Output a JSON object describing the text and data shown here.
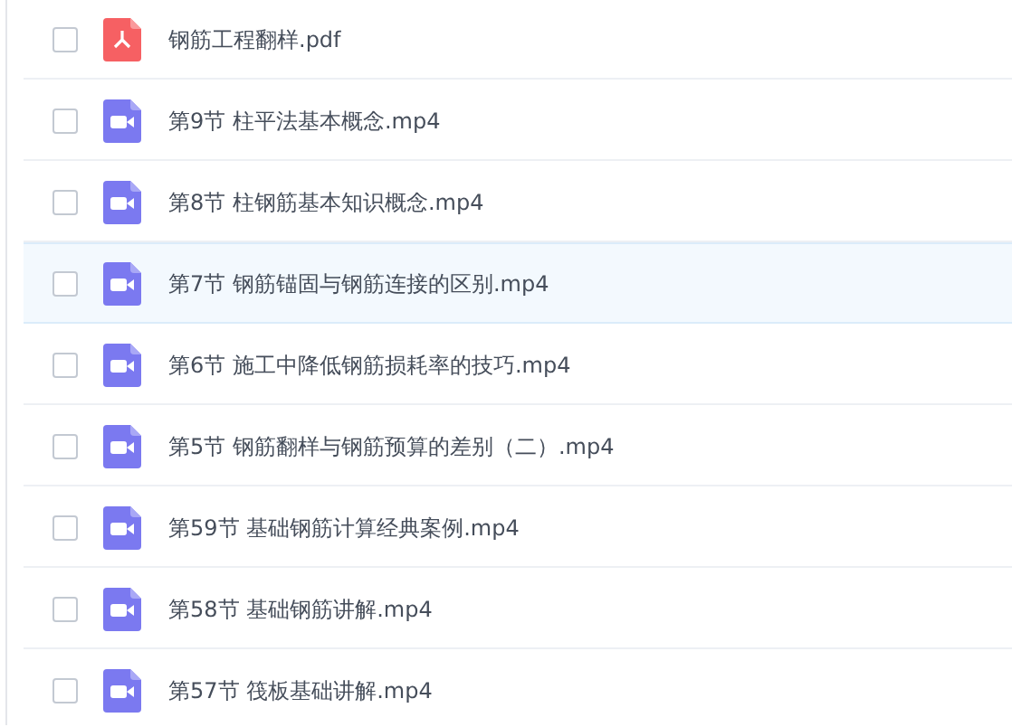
{
  "files": [
    {
      "name": "钢筋工程翻样.pdf",
      "kind": "pdf",
      "checked": false,
      "highlighted": false
    },
    {
      "name": "第9节 柱平法基本概念.mp4",
      "kind": "video",
      "checked": false,
      "highlighted": false
    },
    {
      "name": "第8节 柱钢筋基本知识概念.mp4",
      "kind": "video",
      "checked": false,
      "highlighted": false
    },
    {
      "name": "第7节 钢筋锚固与钢筋连接的区别.mp4",
      "kind": "video",
      "checked": false,
      "highlighted": true
    },
    {
      "name": "第6节 施工中降低钢筋损耗率的技巧.mp4",
      "kind": "video",
      "checked": false,
      "highlighted": false
    },
    {
      "name": "第5节 钢筋翻样与钢筋预算的差别（二）.mp4",
      "kind": "video",
      "checked": false,
      "highlighted": false
    },
    {
      "name": "第59节 基础钢筋计算经典案例.mp4",
      "kind": "video",
      "checked": false,
      "highlighted": false
    },
    {
      "name": "第58节 基础钢筋讲解.mp4",
      "kind": "video",
      "checked": false,
      "highlighted": false
    },
    {
      "name": "第57节 筏板基础讲解.mp4",
      "kind": "video",
      "checked": false,
      "highlighted": false
    }
  ]
}
